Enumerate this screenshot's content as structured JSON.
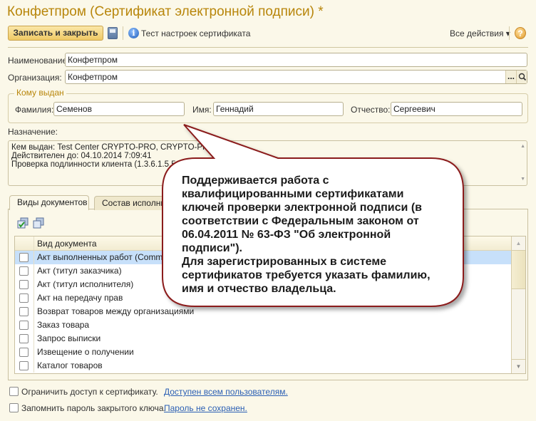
{
  "window": {
    "title": "Конфетпром (Сертификат электронной подписи) *"
  },
  "toolbar": {
    "save_close": "Записать и закрыть",
    "test_settings": "Тест настроек сертификата",
    "all_actions": "Все действия ▾",
    "help": "?"
  },
  "form": {
    "name_label": "Наименование:",
    "name_value": "Конфетпром",
    "org_label": "Организация:",
    "org_value": "Конфетпром",
    "org_select": "...",
    "issued_to": {
      "legend": "Кому выдан",
      "surname_label": "Фамилия:",
      "surname": "Семенов",
      "first_label": "Имя:",
      "first": "Геннадий",
      "patronymic_label": "Отчество:",
      "patronymic": "Сергеевич"
    },
    "purpose_label": "Назначение:",
    "purpose_lines": [
      "Кем выдан: Test Center CRYPTO-PRO, CRYPTO-PRO",
      "Действителен до: 04.10.2014 7:09:41",
      "Проверка подлинности клиента (1.3.6.1.5.5.7.3.2)"
    ]
  },
  "tabs": [
    {
      "label": "Виды документов",
      "active": true
    },
    {
      "label": "Состав исполнителей",
      "active": false
    }
  ],
  "table": {
    "header": "Вид документа",
    "rows": [
      "Акт выполненных работ (CommerceML)",
      "Акт (титул заказчика)",
      "Акт (титул исполнителя)",
      "Акт на передачу прав",
      "Возврат товаров между организациями",
      "Заказ товара",
      "Запрос выписки",
      "Извещение о получении",
      "Каталог товаров"
    ]
  },
  "bottom": {
    "restrict_label": "Ограничить доступ к сертификату.",
    "restrict_link": "Доступен всем пользователям.",
    "remember_label": "Запомнить пароль закрытого ключа.",
    "remember_link": "Пароль не сохранен."
  },
  "callout": {
    "lines": [
      "Поддерживается работа с",
      "квалифицированными сертификатами",
      "ключей проверки электронной подписи (в",
      "соответствии с Федеральным законом от",
      "06.04.2011 № 63-ФЗ \"Об электронной",
      "подписи\").",
      "Для зарегистрированных в системе",
      "сертификатов требуется указать фамилию,",
      "имя и отчество владельца."
    ]
  },
  "colors": {
    "title": "#b8860b",
    "selection": "#c7e0fa",
    "callout_border": "#8b1c1c",
    "link": "#2b5fb4"
  }
}
